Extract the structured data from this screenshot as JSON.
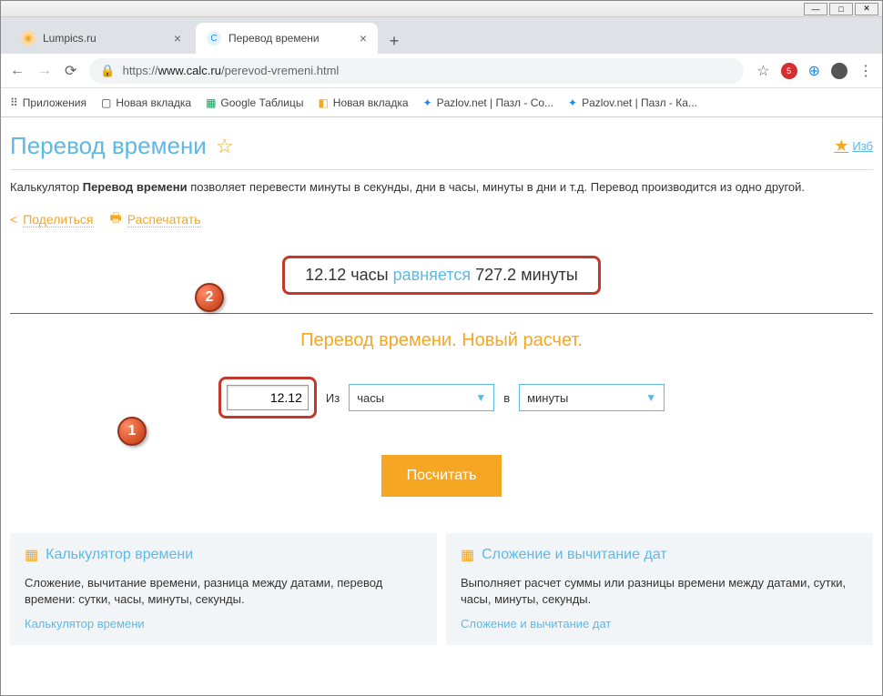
{
  "browser": {
    "tabs": [
      {
        "title": "Lumpics.ru",
        "active": false
      },
      {
        "title": "Перевод времени",
        "active": true
      }
    ],
    "url_prefix": "https://",
    "url_host": "www.calc.ru",
    "url_path": "/perevod-vremeni.html",
    "bookmarks": {
      "apps": "Приложения",
      "items": [
        "Новая вкладка",
        "Google Таблицы",
        "Новая вкладка",
        "Pazlov.net | Пазл - Со...",
        "Pazlov.net | Пазл - Ка..."
      ]
    }
  },
  "page": {
    "title": "Перевод времени",
    "fav_label": "Изб",
    "description_pre": "Калькулятор ",
    "description_bold": "Перевод времени",
    "description_post": " позволяет перевести минуты в секунды, дни в часы, минуты в дни и т.д. Перевод производится из одно другой.",
    "share": "Поделиться",
    "print": "Распечатать",
    "result": {
      "value": "12.12",
      "unit_from": "часы",
      "equals": "равняется",
      "value_to": "727.2",
      "unit_to": "минуты"
    },
    "sub_heading": "Перевод времени. Новый расчет.",
    "form": {
      "input_value": "12.12",
      "label_from": "Из",
      "select_from": "часы",
      "label_to": "в",
      "select_to": "минуты",
      "button": "Посчитать"
    },
    "cards": [
      {
        "title": "Калькулятор времени",
        "text": "Сложение, вычитание времени, разница между датами, перевод времени: сутки, часы, минуты, секунды.",
        "link": "Калькулятор времени"
      },
      {
        "title": "Сложение и вычитание дат",
        "text": "Выполняет расчет суммы или разницы времени между датами, сутки, часы, минуты, секунды.",
        "link": "Сложение и вычитание дат"
      }
    ],
    "badges": {
      "b1": "1",
      "b2": "2"
    }
  }
}
